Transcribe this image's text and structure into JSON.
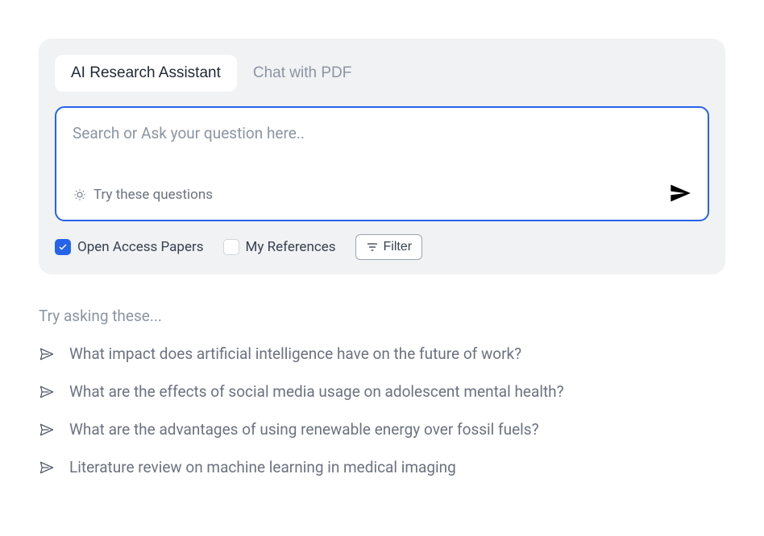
{
  "tabs": {
    "research": "AI Research Assistant",
    "chat_pdf": "Chat with PDF"
  },
  "search": {
    "placeholder": "Search or Ask your question here..",
    "try_label": "Try these questions"
  },
  "options": {
    "open_access": "Open Access Papers",
    "my_references": "My References",
    "filter": "Filter"
  },
  "suggestions": {
    "heading": "Try asking these...",
    "items": [
      "What impact does artificial intelligence have on the future of work?",
      "What are the effects of social media usage on adolescent mental health?",
      "What are the advantages of using renewable energy over fossil fuels?",
      "Literature review on machine learning in medical imaging"
    ]
  }
}
